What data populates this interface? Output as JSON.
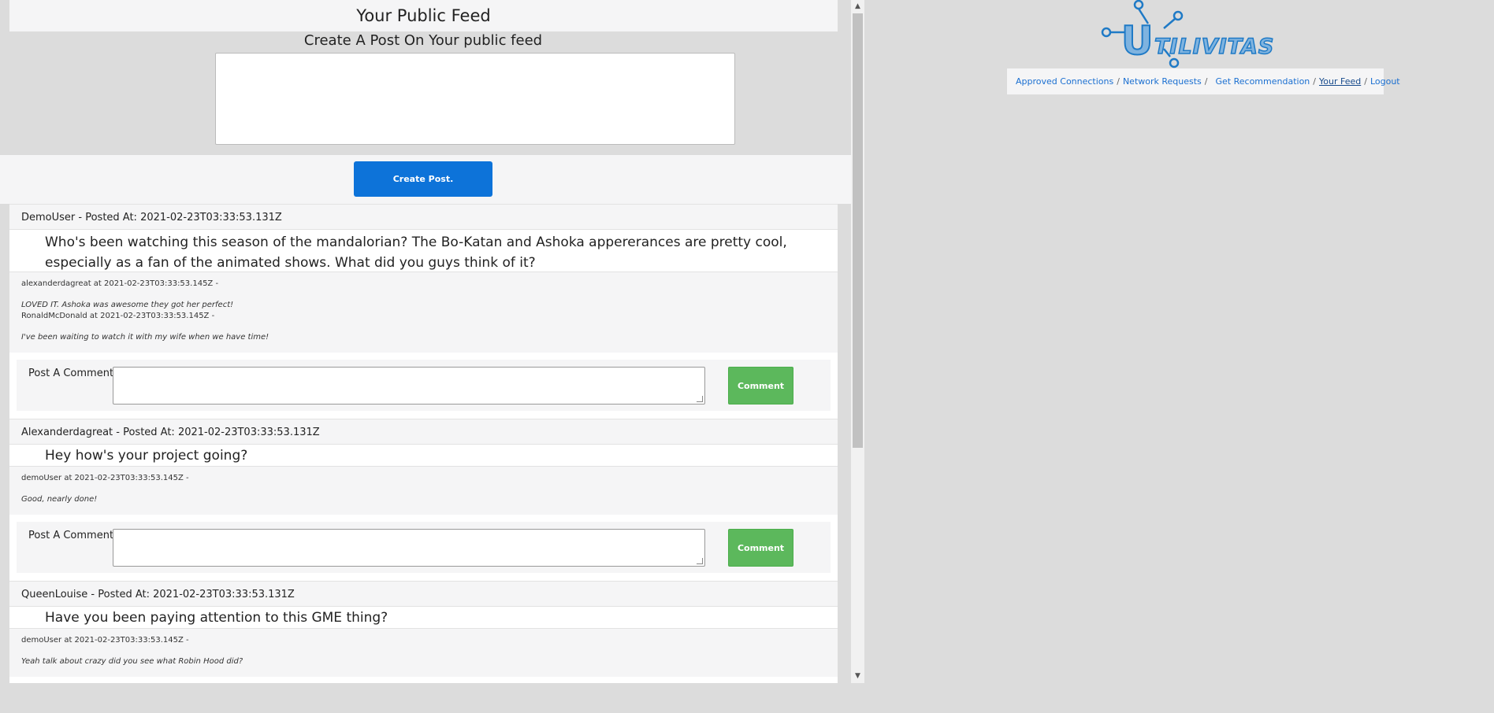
{
  "feed": {
    "title": "Your Public Feed",
    "create_label": "Create A Post On Your public feed",
    "create_button": "Create Post.",
    "comment_label": "Post A Comment:",
    "comment_button": "Comment"
  },
  "posts": [
    {
      "header": "DemoUser - Posted At: 2021-02-23T03:33:53.131Z",
      "body": "Who's been watching this season of the mandalorian? The Bo-Katan and Ashoka appererances are pretty cool, especially as a fan of the animated shows. What did you guys think of it?",
      "comments": [
        {
          "author": "alexanderdagreat at 2021-02-23T03:33:53.145Z -",
          "text": "LOVED IT. Ashoka was awesome they got her perfect!"
        },
        {
          "author": "RonaldMcDonald at 2021-02-23T03:33:53.145Z -",
          "text": "I've been waiting to watch it with my wife when we have time!"
        }
      ]
    },
    {
      "header": "Alexanderdagreat - Posted At: 2021-02-23T03:33:53.131Z",
      "body": "Hey how's your project going?",
      "comments": [
        {
          "author": "demoUser at 2021-02-23T03:33:53.145Z -",
          "text": "Good, nearly done!"
        }
      ]
    },
    {
      "header": "QueenLouise - Posted At: 2021-02-23T03:33:53.131Z",
      "body": "Have you been paying attention to this GME thing?",
      "comments": [
        {
          "author": "demoUser at 2021-02-23T03:33:53.145Z -",
          "text": "Yeah talk about crazy did you see what Robin Hood did?"
        }
      ]
    }
  ],
  "logo": {
    "text": "UtilIVITAS",
    "color": "#1f7ac6"
  },
  "nav": {
    "items": [
      {
        "label": "Approved Connections"
      },
      {
        "label": "Network Requests"
      },
      {
        "label": "Get Recommendation"
      },
      {
        "label": "Your Feed",
        "active": true
      },
      {
        "label": "Logout"
      }
    ],
    "separator": "/"
  },
  "scrollbar": {
    "up_icon": "triangle-up",
    "down_icon": "triangle-down"
  }
}
